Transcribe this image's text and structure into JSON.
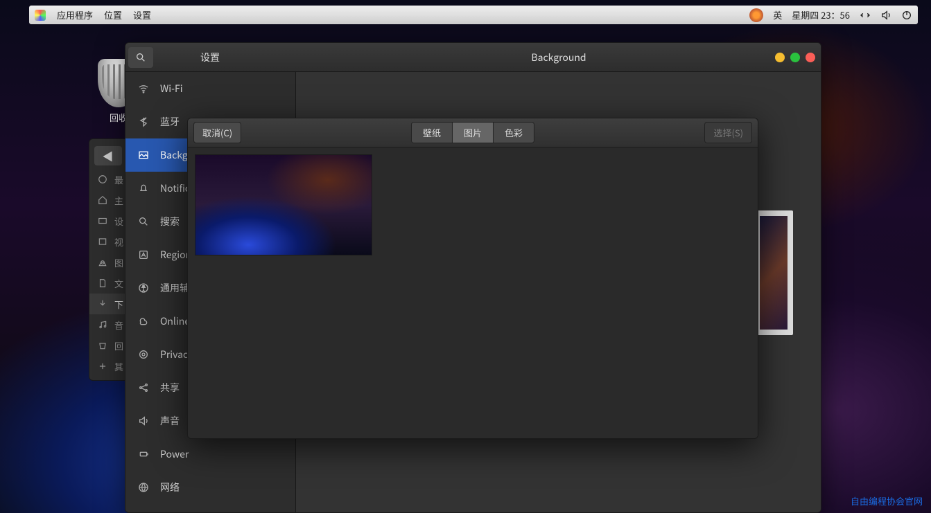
{
  "topbar": {
    "apps": "应用程序",
    "places": "位置",
    "settings": "设置",
    "ime": "英",
    "clock": "星期四 23：56"
  },
  "desktop": {
    "trash_label": "回收"
  },
  "files_sidebar": {
    "items": [
      "最",
      "主",
      "设",
      "视",
      "图",
      "文",
      "下",
      "音",
      "回",
      "其"
    ]
  },
  "settings_window": {
    "title_left": "设置",
    "title_right": "Background",
    "categories": [
      {
        "icon": "wifi",
        "label": "Wi-Fi"
      },
      {
        "icon": "bt",
        "label": "蓝牙"
      },
      {
        "icon": "bg",
        "label": "Background",
        "selected": true
      },
      {
        "icon": "bell",
        "label": "Notifica"
      },
      {
        "icon": "search",
        "label": "搜索"
      },
      {
        "icon": "region",
        "label": "Region"
      },
      {
        "icon": "access",
        "label": "通用辅"
      },
      {
        "icon": "online",
        "label": "Online"
      },
      {
        "icon": "privacy",
        "label": "Privacy"
      },
      {
        "icon": "share",
        "label": "共享"
      },
      {
        "icon": "sound",
        "label": "声音"
      },
      {
        "icon": "power",
        "label": "Power"
      },
      {
        "icon": "net",
        "label": "网络"
      }
    ]
  },
  "chooser": {
    "cancel": "取消(C)",
    "select": "选择(S)",
    "tabs": {
      "wallpaper": "壁纸",
      "pictures": "图片",
      "colors": "色彩"
    },
    "active_tab": "pictures"
  },
  "watermark": "自由编程协会官网"
}
